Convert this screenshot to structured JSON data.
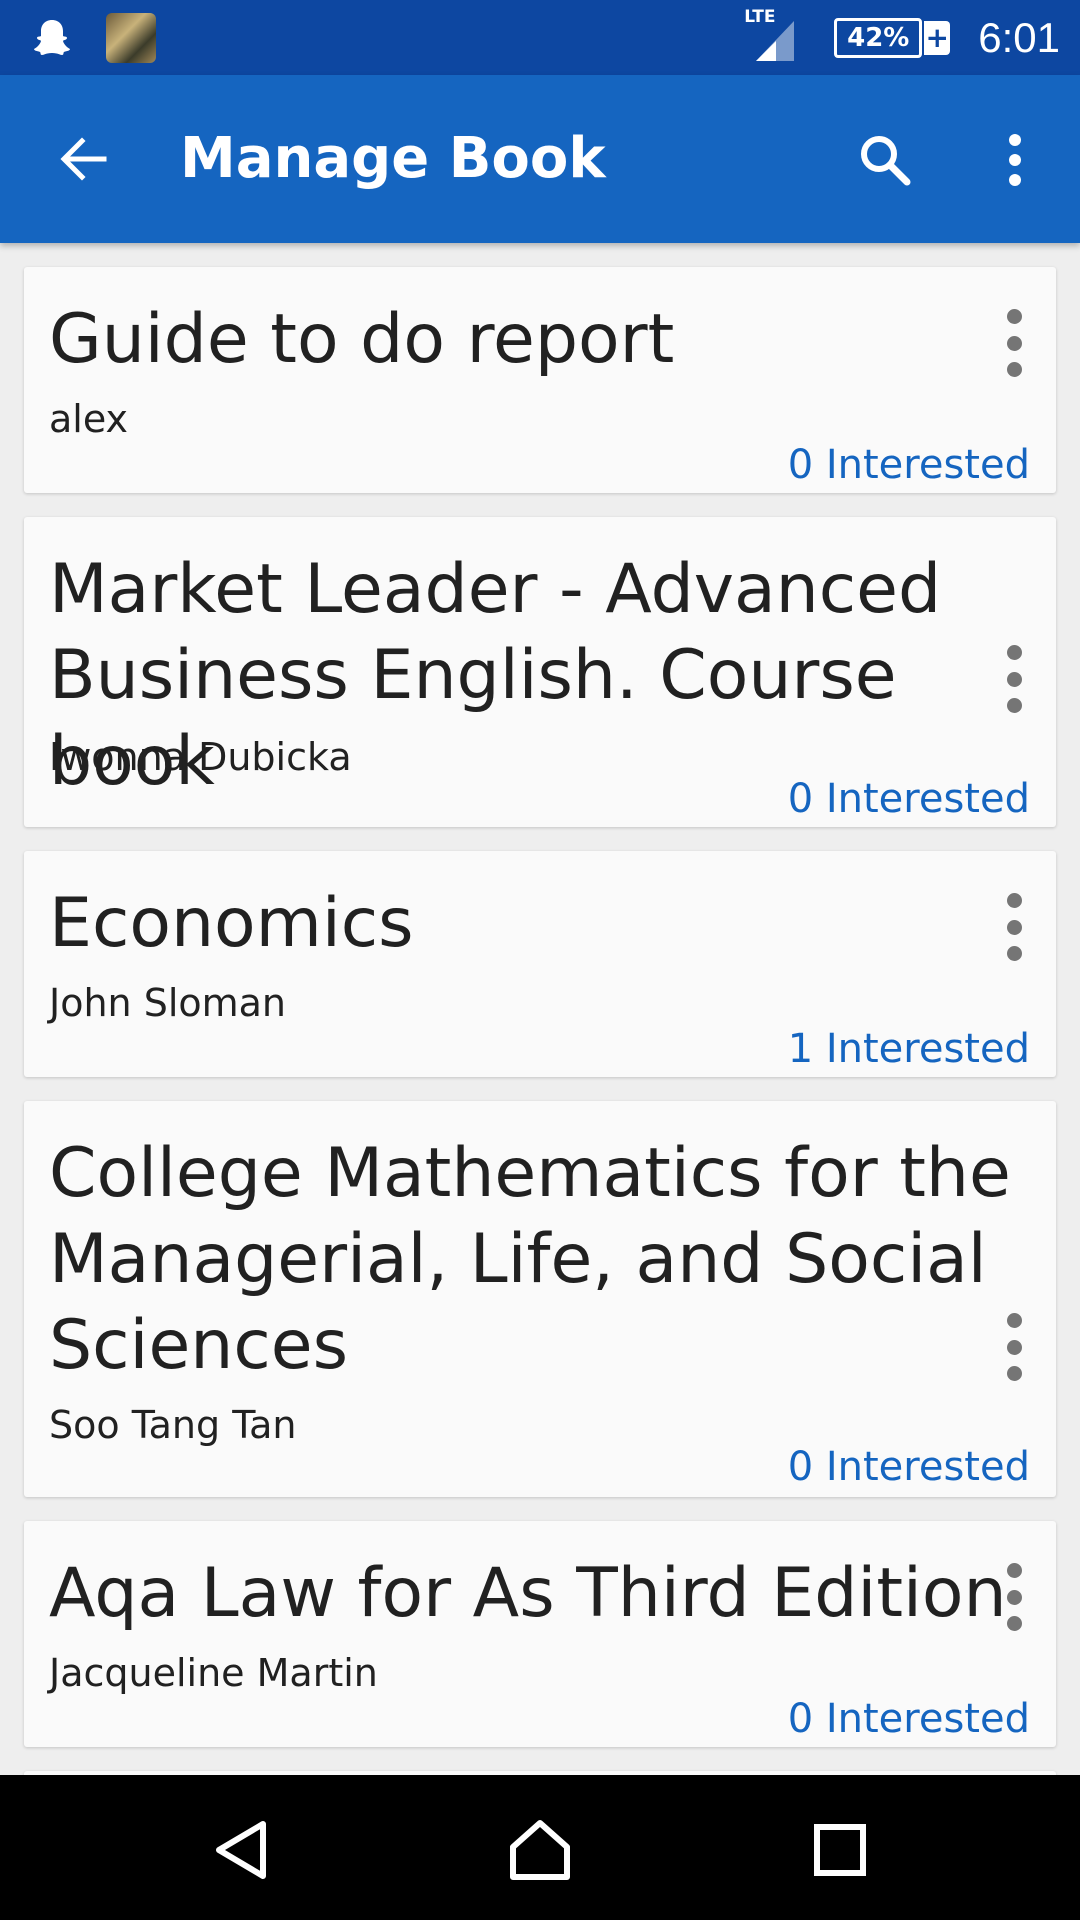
{
  "status_bar": {
    "network_label": "LTE",
    "battery_percent": "42%",
    "battery_charging_symbol": "+",
    "time": "6:01",
    "icons": [
      "snapchat-icon",
      "game-app-icon",
      "signal-icon",
      "battery-icon"
    ]
  },
  "app_bar": {
    "title": "Manage Book",
    "icons": [
      "back-arrow-icon",
      "search-icon",
      "more-vert-icon"
    ]
  },
  "books": [
    {
      "title": "Guide to do report",
      "author": "alex",
      "interested": "0 Interested"
    },
    {
      "title": "Market Leader - Advanced Business English. Course book",
      "author": "Iwonna Dubicka",
      "interested": "0 Interested"
    },
    {
      "title": "Economics",
      "author": "John Sloman",
      "interested": "1 Interested"
    },
    {
      "title": "College Mathematics for the Managerial, Life, and Social Sciences",
      "author": "Soo Tang Tan",
      "interested": "0 Interested"
    },
    {
      "title": "Aqa Law for As Third Edition",
      "author": "Jacqueline Martin",
      "interested": "0 Interested"
    }
  ],
  "nav_bar": {
    "icons": [
      "back-triangle-icon",
      "home-icon",
      "recents-square-icon"
    ]
  },
  "colors": {
    "status_bar": "#0d47a1",
    "app_bar": "#1565c0",
    "accent_text": "#1565c0",
    "card_bg": "#fafafa",
    "list_bg": "#eeeeee"
  }
}
